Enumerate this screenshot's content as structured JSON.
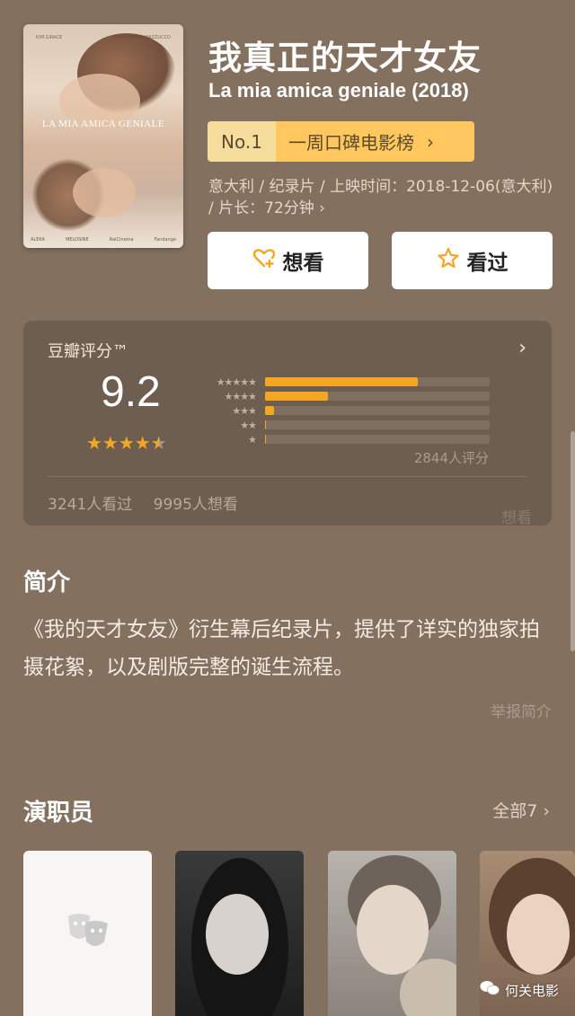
{
  "movie": {
    "title_cn": "我真正的天才女友",
    "title_en": "La mia amica geniale (2018)",
    "poster": {
      "title": "LA MIA AMICA GENIALE",
      "top_left": "KIM GIRACE",
      "top_right": "MARGHERITA MAZZUCCO",
      "bottom_items": [
        "ALEKA",
        "MELOSINE",
        "RaiCinema",
        "Fandango"
      ]
    }
  },
  "rank": {
    "no": "No.1",
    "label": "一周口碑电影榜",
    "chevron": "›"
  },
  "meta": "意大利 / 纪录片 / 上映时间：2018-12-06(意大利) / 片长：72分钟 ›",
  "actions": {
    "want_label": "想看",
    "seen_label": "看过"
  },
  "rating": {
    "title": "豆瓣评分™",
    "score": "9.2",
    "stars": "★★★★★",
    "distribution": [
      {
        "stars": "★★★★★",
        "pct": 68
      },
      {
        "stars": "★★★★",
        "pct": 28
      },
      {
        "stars": "★★★",
        "pct": 4
      },
      {
        "stars": "★★",
        "pct": 0.5
      },
      {
        "stars": "★",
        "pct": 0.5
      }
    ],
    "count_text": "2844人评分",
    "seen_text": "3241人看过",
    "want_text": "9995人想看",
    "badge_text": "想看"
  },
  "intro": {
    "heading": "简介",
    "text": "《我的天才女友》衍生幕后纪录片，提供了详实的独家拍摄花絮，以及剧版完整的诞生流程。",
    "report": "举报简介"
  },
  "cast": {
    "heading": "演职员",
    "all_label": "全部7 ›"
  },
  "watermark": "何关电影",
  "colors": {
    "accent": "#f5a623",
    "rank_light": "#f4dd9d",
    "rank_dark": "#ffc75e",
    "bg": "#83705f"
  }
}
